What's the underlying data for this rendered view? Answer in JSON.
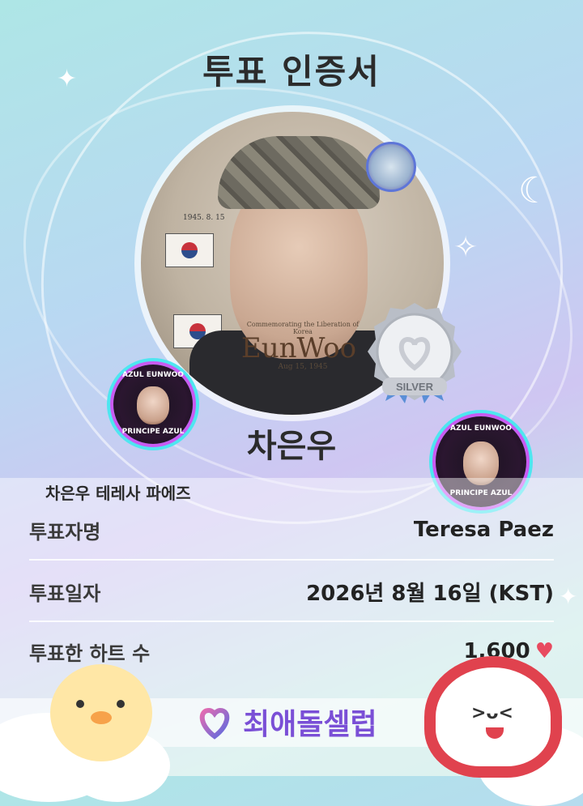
{
  "title": "투표 인증서",
  "photo": {
    "caption": "Commemorating the Liberation of Korea",
    "brand": "EunWoo",
    "date_line": "Aug 15, 1945",
    "year_note": "1945. 8. 15"
  },
  "medal": {
    "label": "SILVER"
  },
  "fan_badge": {
    "top_text": "AZUL EUNWOO",
    "bottom_text": "PRINCIPE AZUL"
  },
  "artist_name": "차은우",
  "fan_name": "차은우 테레사 파에즈",
  "rows": [
    {
      "label": "투표자명",
      "value": "Teresa Paez"
    },
    {
      "label": "투표일자",
      "value": "2026년 8월 16일 (KST)"
    },
    {
      "label": "투표한 하트 수",
      "value": "1,600"
    }
  ],
  "brand_logo": "최애돌셀럽",
  "colors": {
    "heart": "#e84a5f",
    "logo": "#7a4fd6",
    "medal": "#c9ccd3"
  }
}
